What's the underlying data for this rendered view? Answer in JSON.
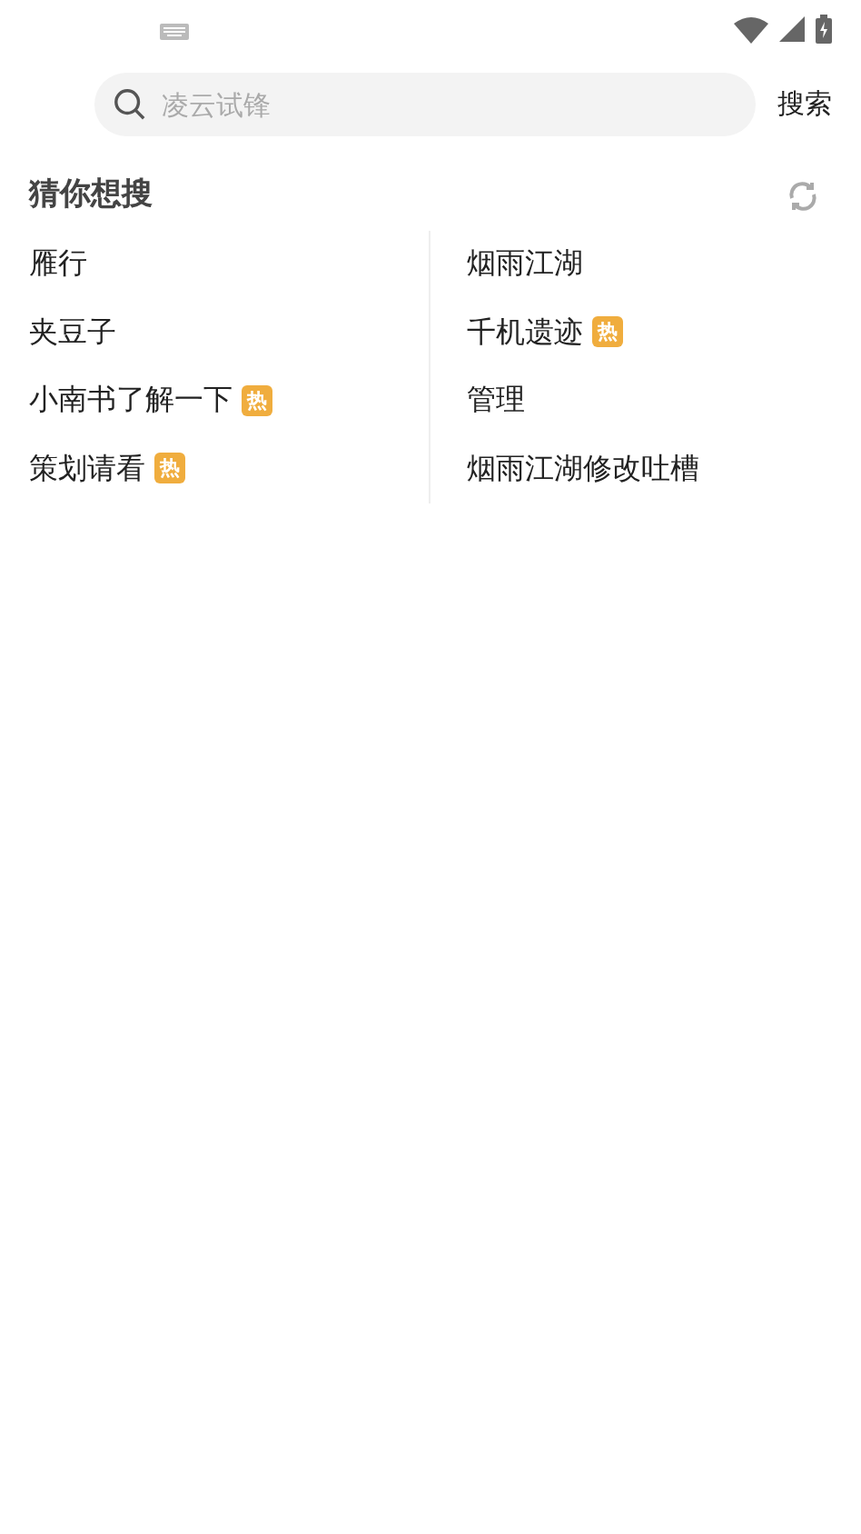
{
  "search": {
    "placeholder": "凌云试锋",
    "button": "搜索"
  },
  "suggestions": {
    "title": "猜你想搜",
    "columns": [
      [
        {
          "label": "雁行"
        },
        {
          "label": "夹豆子"
        },
        {
          "label": "小南书了解一下",
          "badge": "热"
        },
        {
          "label": "策划请看",
          "badge": "热"
        }
      ],
      [
        {
          "label": "烟雨江湖"
        },
        {
          "label": "千机遗迹",
          "badge": "热"
        },
        {
          "label": "管理"
        },
        {
          "label": "烟雨江湖修改吐槽"
        }
      ]
    ]
  }
}
